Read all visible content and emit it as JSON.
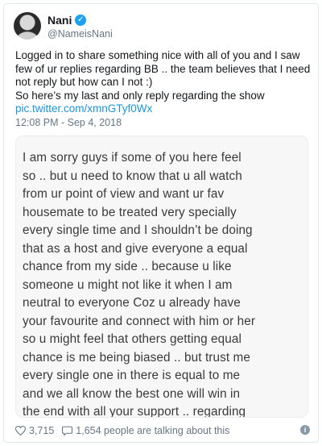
{
  "user": {
    "display_name": "Nani",
    "handle": "@NameisNani"
  },
  "tweet": {
    "text_lines": [
      "Logged in to share something nice with all of you and I saw few of ur replies regarding BB .. the team believes that I need not reply but how can I not :)",
      "So here’s my last and only reply regarding the show"
    ],
    "link": "pic.twitter.com/xmnGTyf0Wx",
    "timestamp": "12:08 PM - Sep 4, 2018"
  },
  "image": {
    "lines": [
      "I am sorry guys if some of you here feel",
      "so .. but u need to know that u all watch",
      "from ur point of view and want ur fav",
      "housemate to be treated very specially",
      "every single time and I shouldn’t be doing",
      "that as a host and give everyone a equal",
      "chance from my side .. because u like",
      "someone u might not like it when I am",
      "neutral to everyone Coz u already have",
      "your favourite and connect with him or her",
      "so u might feel that others getting equal",
      "chance is me being biased .. but trust me",
      "every single one in there is equal to me",
      "and we all know the best one will win in",
      "the end with all your support .. regarding"
    ]
  },
  "footer": {
    "likes": "3,715",
    "talking": "1,654 people are talking about this"
  },
  "icons": {
    "like": "heart-icon",
    "talk": "comment-icon",
    "info": "info-icon",
    "verified": "verified-badge-icon"
  },
  "colors": {
    "link": "#1b95e0",
    "verified": "#1da1f2",
    "muted": "#657786"
  }
}
